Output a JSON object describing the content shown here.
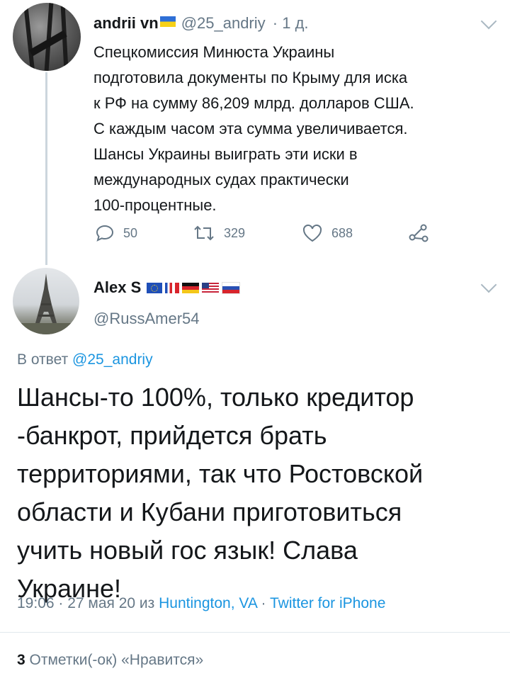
{
  "tweet": {
    "author_name": "andrii vn",
    "author_handle": "@25_andriy",
    "age": "· 1 д.",
    "text_lines": [
      "Спецкомиссия Минюста Украины",
      "подготовила документы по Крыму для иска",
      "к РФ на сумму 86,209 млрд. долларов США.",
      "С каждым часом эта сумма увеличивается.",
      "Шансы Украины выиграть эти иски в",
      "международных судах практически",
      "100-процентные."
    ],
    "replies": "50",
    "retweets": "329",
    "likes": "688"
  },
  "reply": {
    "author_name": "Alex S",
    "author_handle": "@RussAmer54",
    "in_reply_prefix": "В ответ",
    "in_reply_to": "@25_andriy",
    "text_lines": [
      "Шансы-то 100%, только кредитор",
      "-банкрот, прийдется брать",
      "территориями, так что Ростовской",
      "области и Кубани приготовиться",
      "учить новый гос язык! Слава",
      "Украине!"
    ],
    "time": "19:06 · 27 мая 20 из",
    "location": "Huntington, VA",
    "source_sep": "·",
    "source": "Twitter for iPhone",
    "likes_count": "3",
    "likes_label": "Отметки(-ок) «Нравится»"
  },
  "colors": {
    "link": "#1b95e0",
    "muted": "#657786",
    "text": "#14171a"
  }
}
